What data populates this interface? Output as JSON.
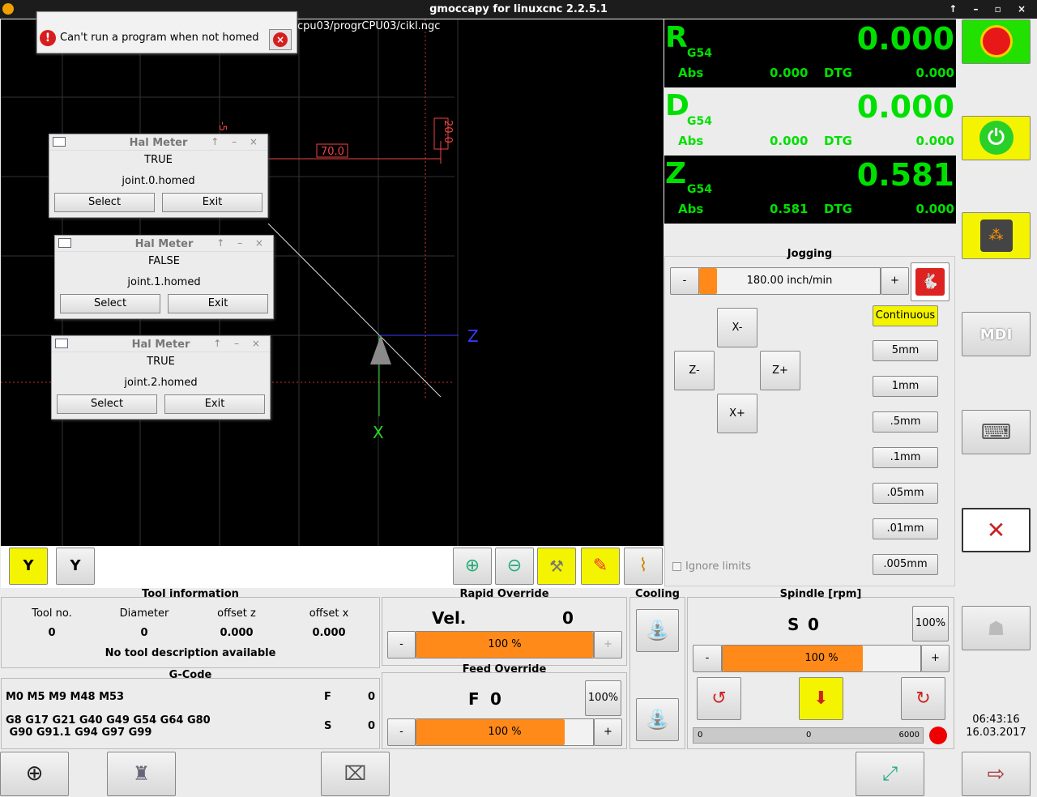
{
  "window": {
    "title": "gmoccapy for linuxcnc  2.2.5.1",
    "controls": "↑ – ▫ ×"
  },
  "preview": {
    "filepath": "cpu03/progrCPU03/cikl.ngc",
    "dim_horizontal": "70.0",
    "dim_vertical": "20.0",
    "dim_partial": "-5",
    "axis_z_label": "Z",
    "axis_x_label": "X"
  },
  "error_popup": {
    "message": "Can't run a program when not homed",
    "icon": "!",
    "close": "×"
  },
  "hal_meters": [
    {
      "title": "Hal Meter",
      "value": "TRUE",
      "pin": "joint.0.homed",
      "select": "Select",
      "exit": "Exit"
    },
    {
      "title": "Hal Meter",
      "value": "FALSE",
      "pin": "joint.1.homed",
      "select": "Select",
      "exit": "Exit"
    },
    {
      "title": "Hal Meter",
      "value": "TRUE",
      "pin": "joint.2.homed",
      "select": "Select",
      "exit": "Exit"
    }
  ],
  "dro": [
    {
      "axis": "R",
      "offset": "G54",
      "value": "0.000",
      "abs_label": "Abs",
      "abs": "0.000",
      "dtg_label": "DTG",
      "dtg": "0.000"
    },
    {
      "axis": "D",
      "offset": "G54",
      "value": "0.000",
      "abs_label": "Abs",
      "abs": "0.000",
      "dtg_label": "DTG",
      "dtg": "0.000"
    },
    {
      "axis": "Z",
      "offset": "G54",
      "value": "0.581",
      "abs_label": "Abs",
      "abs": "0.581",
      "dtg_label": "DTG",
      "dtg": "0.000"
    }
  ],
  "jogging": {
    "title": "Jogging",
    "minus": "-",
    "plus": "+",
    "speed": "180.00 inch/min",
    "speed_fraction": 0.0,
    "buttons": {
      "x_minus": "X-",
      "x_plus": "X+",
      "z_minus": "Z-",
      "z_plus": "Z+"
    },
    "increments": [
      "Continuous",
      "5mm",
      "1mm",
      ".5mm",
      ".1mm",
      ".05mm",
      ".01mm",
      ".005mm"
    ],
    "ignore_limits": "Ignore limits"
  },
  "tool_info": {
    "title": "Tool information",
    "headers": [
      "Tool no.",
      "Diameter",
      "offset z",
      "offset x"
    ],
    "values": [
      "0",
      "0",
      "0.000",
      "0.000"
    ],
    "description": "No tool description available"
  },
  "gcode": {
    "title": "G-Code",
    "mcodes": "M0 M5 M9 M48 M53",
    "gcodes_line1": "G8 G17 G21 G40 G49 G54 G64 G80",
    "gcodes_line2": " G90 G91.1 G94 G97 G99",
    "f_label": "F",
    "f_value": "0",
    "s_label": "S",
    "s_value": "0"
  },
  "rapid_override": {
    "title": "Rapid Override",
    "vel_label": "Vel.",
    "vel_value": "0",
    "percent": "100 %",
    "level": 1.0,
    "minus": "-",
    "plus": "+"
  },
  "feed_override": {
    "title": "Feed Override",
    "f_label": "F",
    "f_value": "0",
    "reset": "100%",
    "percent": "100 %",
    "level": 0.84,
    "minus": "-",
    "plus": "+"
  },
  "cooling": {
    "title": "Cooling"
  },
  "spindle": {
    "title": "Spindle [rpm]",
    "s_label": "S",
    "s_value": "0",
    "reset": "100%",
    "percent": "100 %",
    "level": 0.71,
    "minus": "-",
    "plus": "+",
    "bar_min": "0",
    "bar_mid": "0",
    "bar_max": "6000"
  },
  "clock": {
    "time": "06:43:16",
    "date": "16.03.2017"
  },
  "colors": {
    "dro_green": "#00e000",
    "accent_yellow": "#f4f400",
    "orange": "#ff8a1a",
    "estop_green": "#22e000"
  }
}
